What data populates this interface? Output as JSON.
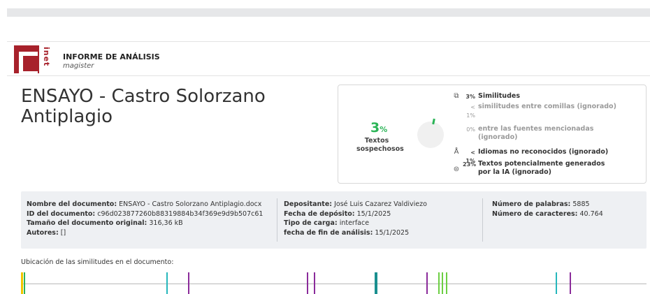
{
  "header": {
    "logo_text": "inet",
    "title": "INFORME DE ANÁLISIS",
    "subtitle": "magister"
  },
  "document": {
    "title": "ENSAYO - Castro Solorzano Antiplagio"
  },
  "summary": {
    "suspicious_pct": "3",
    "pct_sign": "%",
    "suspicious_label": "Textos sospechosos",
    "metrics": [
      {
        "icon": "copy-icon",
        "pct": "3%",
        "text": "Similitudes",
        "sub": false
      },
      {
        "icon": "",
        "pct": "< 1%",
        "text": "similitudes entre comillas (ignorado)",
        "sub": true
      },
      {
        "icon": "",
        "pct": "0%",
        "text": "entre las fuentes mencionadas (ignorado)",
        "sub": true
      },
      {
        "icon": "language-icon",
        "pct": "< 1%",
        "text": "Idiomas no reconocidos (ignorado)",
        "sub": false
      },
      {
        "icon": "ai-icon",
        "pct": "23%",
        "text": "Textos potencialmente generados por la IA (ignorado)",
        "sub": false
      }
    ]
  },
  "info": {
    "nombre_label": "Nombre del documento:",
    "nombre_value": "ENSAYO - Castro Solorzano Antiplagio.docx",
    "id_label": "ID del documento:",
    "id_value": "c96d023877260b88319884b34f369e9d9b507c61",
    "tamano_label": "Tamaño del documento original:",
    "tamano_value": "316,36 kB",
    "autores_label": "Autores:",
    "autores_value": "[]",
    "depositante_label": "Depositante:",
    "depositante_value": "José Luis Cazarez Valdiviezo",
    "fecha_label": "Fecha de depósito:",
    "fecha_value": "15/1/2025",
    "tipo_label": "Tipo de carga:",
    "tipo_value": "interface",
    "fin_label": "fecha de fin de análisis:",
    "fin_value": "15/1/2025",
    "palabras_label": "Número de palabras:",
    "palabras_value": "5885",
    "caracteres_label": "Número de caracteres:",
    "caracteres_value": "40.764"
  },
  "location": {
    "label": "Ubicación de las similitudes en el documento:",
    "markers": [
      {
        "pos": 0.0,
        "color": "#f2c500",
        "weight": 3
      },
      {
        "pos": 0.004,
        "color": "#2bb457",
        "weight": 2
      },
      {
        "pos": 0.233,
        "color": "#26b7bc",
        "weight": 2
      },
      {
        "pos": 0.268,
        "color": "#8a2b9a",
        "weight": 2
      },
      {
        "pos": 0.459,
        "color": "#8a2b9a",
        "weight": 2
      },
      {
        "pos": 0.47,
        "color": "#8a2b9a",
        "weight": 2
      },
      {
        "pos": 0.568,
        "color": "#1a8f8f",
        "weight": 4
      },
      {
        "pos": 0.651,
        "color": "#8a2b9a",
        "weight": 2
      },
      {
        "pos": 0.67,
        "color": "#6dcf44",
        "weight": 2
      },
      {
        "pos": 0.676,
        "color": "#6dcf44",
        "weight": 2
      },
      {
        "pos": 0.682,
        "color": "#6dcf44",
        "weight": 2
      },
      {
        "pos": 0.859,
        "color": "#26b7bc",
        "weight": 2
      },
      {
        "pos": 0.881,
        "color": "#8a2b9a",
        "weight": 2
      }
    ]
  }
}
